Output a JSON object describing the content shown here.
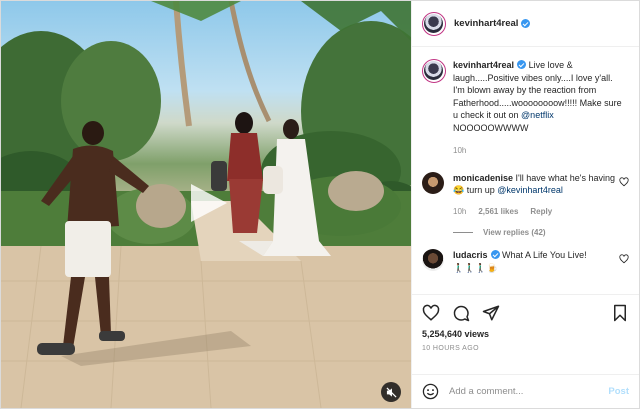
{
  "post": {
    "author": "kevinhart4real",
    "caption": {
      "user": "kevinhart4real",
      "text": "Live love & laugh.....Positive vibes only....I love y'all. I'm blown away by the reaction from Fatherhood.....woooooooow!!!!! Make sure u check it out on ",
      "mention": "@netflix",
      "text_end": " NOOOOOWWWW",
      "time": "10h"
    },
    "comments": [
      {
        "user": "monicadenise",
        "text": "I'll have what he's having 😂 turn up ",
        "mention": "@kevinhart4real",
        "time": "10h",
        "likes": "2,561 likes",
        "reply_label": "Reply",
        "view_replies": "View replies (42)"
      },
      {
        "user": "ludacris",
        "text": "What A Life You Live!",
        "emoji": "🚶🏾‍♂️🚶🏾‍♂️🚶🏾‍♂️🍺"
      }
    ],
    "likes": "5,254,640 views",
    "ago": "10 HOURS AGO",
    "add_comment_placeholder": "Add a comment...",
    "post_button": "Post"
  },
  "colors": {
    "link": "#00376b",
    "verified": "#3897f0",
    "post_disabled": "#b2dffc",
    "muted": "#8e8e8e"
  },
  "icons": {
    "play": "play-icon",
    "mute": "speaker-muted-icon",
    "like": "heart-icon",
    "comment": "comment-bubble-icon",
    "share": "paper-plane-icon",
    "save": "bookmark-icon",
    "emoji": "smiley-icon"
  }
}
